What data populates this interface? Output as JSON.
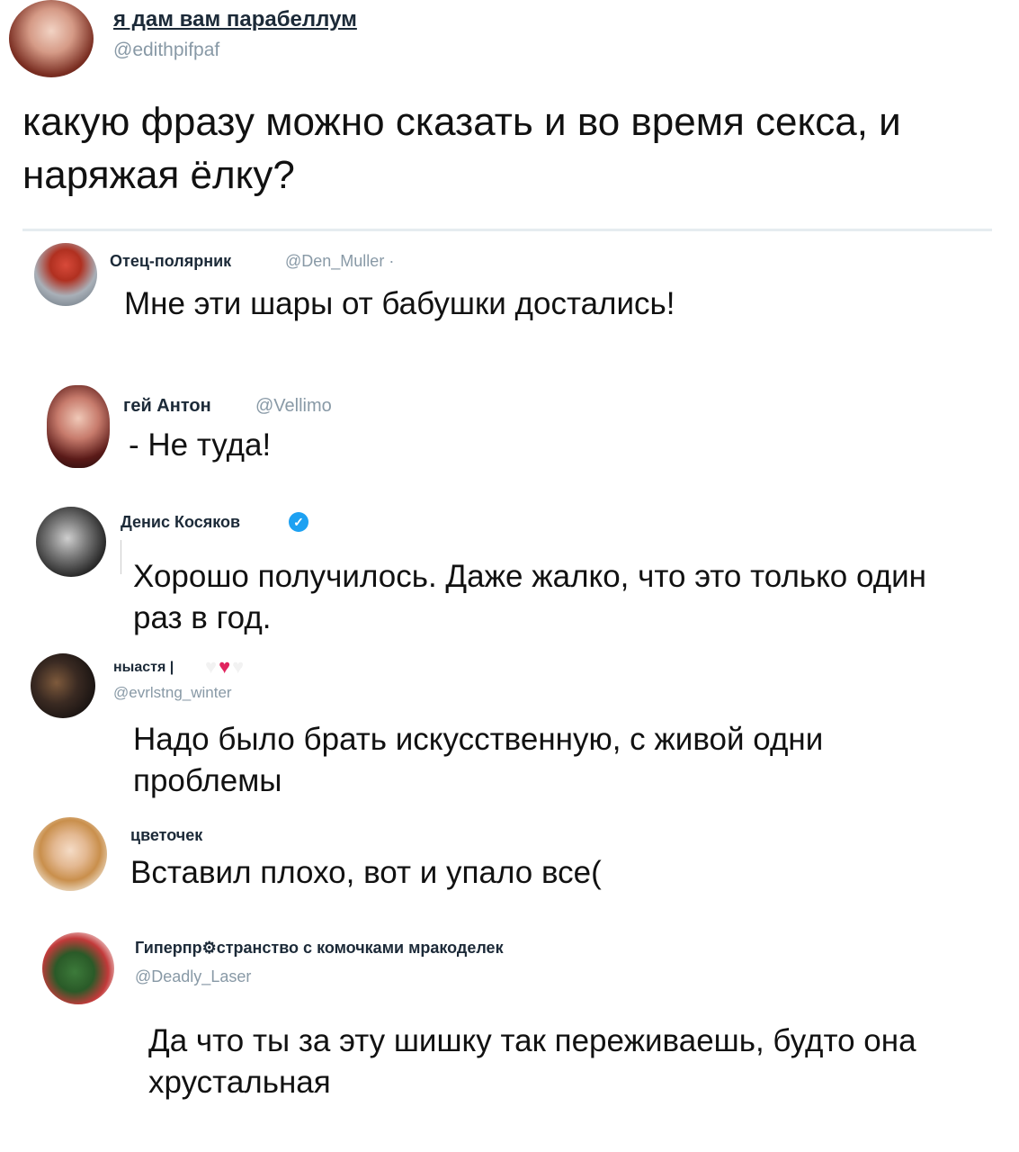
{
  "main_tweet": {
    "name": "я дам вам парабеллум",
    "handle": "@edithpifpaf",
    "text": "какую фразу можно сказать и во время секса, и наряжая ёлку?"
  },
  "replies": [
    {
      "name": "Отец-полярник",
      "handle": "@Den_Muller ·",
      "text": "Мне эти шары от бабушки достались!"
    },
    {
      "name": "гей Антон",
      "handle": "@Vellimo",
      "text": "- Не туда!"
    },
    {
      "name": "Денис Косяков",
      "handle": "",
      "verified": true,
      "text": "Хорошо получилось. Даже жалко, что это только один раз в год."
    },
    {
      "name": "ныастя |",
      "handle": "@evrlstng_winter",
      "hearts": [
        "white-heart-icon",
        "red-heart-icon",
        "white-heart-icon"
      ],
      "text": "Надо было брать искусственную, с живой одни проблемы"
    },
    {
      "name": "цветочек",
      "handle": "",
      "text": "Вставил плохо, вот и упало все("
    },
    {
      "name": "Гиперпр⚙странство с комочками мракоделек",
      "handle": "@Deadly_Laser",
      "text": "Да что ты за эту шишку так переживаешь, будто она хрустальная"
    }
  ],
  "colors": {
    "name": "#1c2a38",
    "handle": "#8899a6",
    "verified": "#1da1f2",
    "divider": "#e6ecf0",
    "heart_red": "#e0245e"
  }
}
